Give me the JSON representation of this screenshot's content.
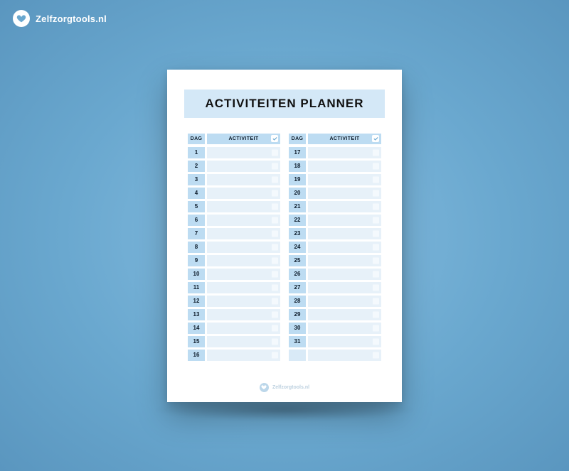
{
  "brand": {
    "name": "Zelfzorgtools.nl"
  },
  "document": {
    "title": "ACTIVITEITEN PLANNER",
    "header": {
      "day": "DAG",
      "activity": "ACTIVITEIT"
    },
    "col1": [
      {
        "day": "1"
      },
      {
        "day": "2"
      },
      {
        "day": "3"
      },
      {
        "day": "4"
      },
      {
        "day": "5"
      },
      {
        "day": "6"
      },
      {
        "day": "7"
      },
      {
        "day": "8"
      },
      {
        "day": "9"
      },
      {
        "day": "10"
      },
      {
        "day": "11"
      },
      {
        "day": "12"
      },
      {
        "day": "13"
      },
      {
        "day": "14"
      },
      {
        "day": "15"
      },
      {
        "day": "16"
      }
    ],
    "col2": [
      {
        "day": "17"
      },
      {
        "day": "18"
      },
      {
        "day": "19"
      },
      {
        "day": "20"
      },
      {
        "day": "21"
      },
      {
        "day": "22"
      },
      {
        "day": "23"
      },
      {
        "day": "24"
      },
      {
        "day": "25"
      },
      {
        "day": "26"
      },
      {
        "day": "27"
      },
      {
        "day": "28"
      },
      {
        "day": "29"
      },
      {
        "day": "30"
      },
      {
        "day": "31"
      },
      {
        "day": "",
        "faded": true
      }
    ],
    "footer_brand": "Zelfzorgtools.nl"
  }
}
